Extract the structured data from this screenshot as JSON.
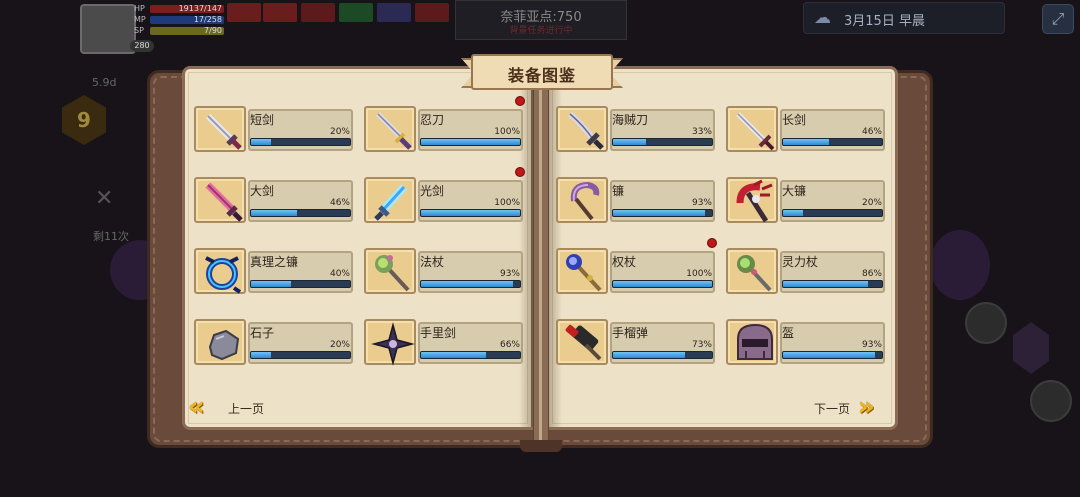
{
  "book": {
    "title": "装备图鉴",
    "prev_label": "上一页",
    "next_label": "下一页"
  },
  "left_page": [
    {
      "name": "短剑",
      "pct_text": "20%",
      "progress": 20,
      "new": false,
      "icon": "short-sword-icon"
    },
    {
      "name": "忍刀",
      "pct_text": "100%",
      "progress": 100,
      "new": true,
      "icon": "ninja-blade-icon"
    },
    {
      "name": "大剑",
      "pct_text": "46%",
      "progress": 46,
      "new": false,
      "icon": "great-sword-icon"
    },
    {
      "name": "光剑",
      "pct_text": "100%",
      "progress": 100,
      "new": true,
      "icon": "light-sword-icon"
    },
    {
      "name": "真理之镰",
      "pct_text": "40%",
      "progress": 40,
      "new": false,
      "icon": "truth-scythe-icon"
    },
    {
      "name": "法杖",
      "pct_text": "93%",
      "progress": 93,
      "new": false,
      "icon": "magic-staff-icon"
    },
    {
      "name": "石子",
      "pct_text": "20%",
      "progress": 20,
      "new": false,
      "icon": "stone-icon"
    },
    {
      "name": "手里剑",
      "pct_text": "66%",
      "progress": 66,
      "new": false,
      "icon": "shuriken-icon"
    }
  ],
  "right_page": [
    {
      "name": "海贼刀",
      "pct_text": "33%",
      "progress": 33,
      "new": false,
      "icon": "pirate-sword-icon"
    },
    {
      "name": "长剑",
      "pct_text": "46%",
      "progress": 46,
      "new": false,
      "icon": "long-sword-icon"
    },
    {
      "name": "镰",
      "pct_text": "93%",
      "progress": 93,
      "new": false,
      "icon": "sickle-icon"
    },
    {
      "name": "大镰",
      "pct_text": "20%",
      "progress": 20,
      "new": false,
      "icon": "great-scythe-icon"
    },
    {
      "name": "权杖",
      "pct_text": "100%",
      "progress": 100,
      "new": true,
      "icon": "scepter-icon"
    },
    {
      "name": "灵力杖",
      "pct_text": "86%",
      "progress": 86,
      "new": false,
      "icon": "spirit-staff-icon"
    },
    {
      "name": "手榴弹",
      "pct_text": "73%",
      "progress": 73,
      "new": false,
      "icon": "grenade-icon"
    },
    {
      "name": "盔",
      "pct_text": "93%",
      "progress": 93,
      "new": false,
      "icon": "helmet-icon"
    }
  ],
  "hud": {
    "hp_label": "HP",
    "hp_value": "19137/147",
    "mp_label": "MP",
    "mp_value": "17/258",
    "sp_label": "SP",
    "sp_value": "7/90",
    "level": "280",
    "center_title": "奈菲亚点:750",
    "center_sub": "背景任务进行中",
    "date": "3月15日 早晨",
    "floor_number": "9",
    "time_left": "5.9d",
    "count_text": "剩11次"
  },
  "colors": {
    "page": "#ede2c8",
    "icon_bg": "#e9cc8e",
    "bar_fill": "#3f9fe0",
    "new_dot": "#c01818",
    "arrow": "#f2b51e"
  }
}
